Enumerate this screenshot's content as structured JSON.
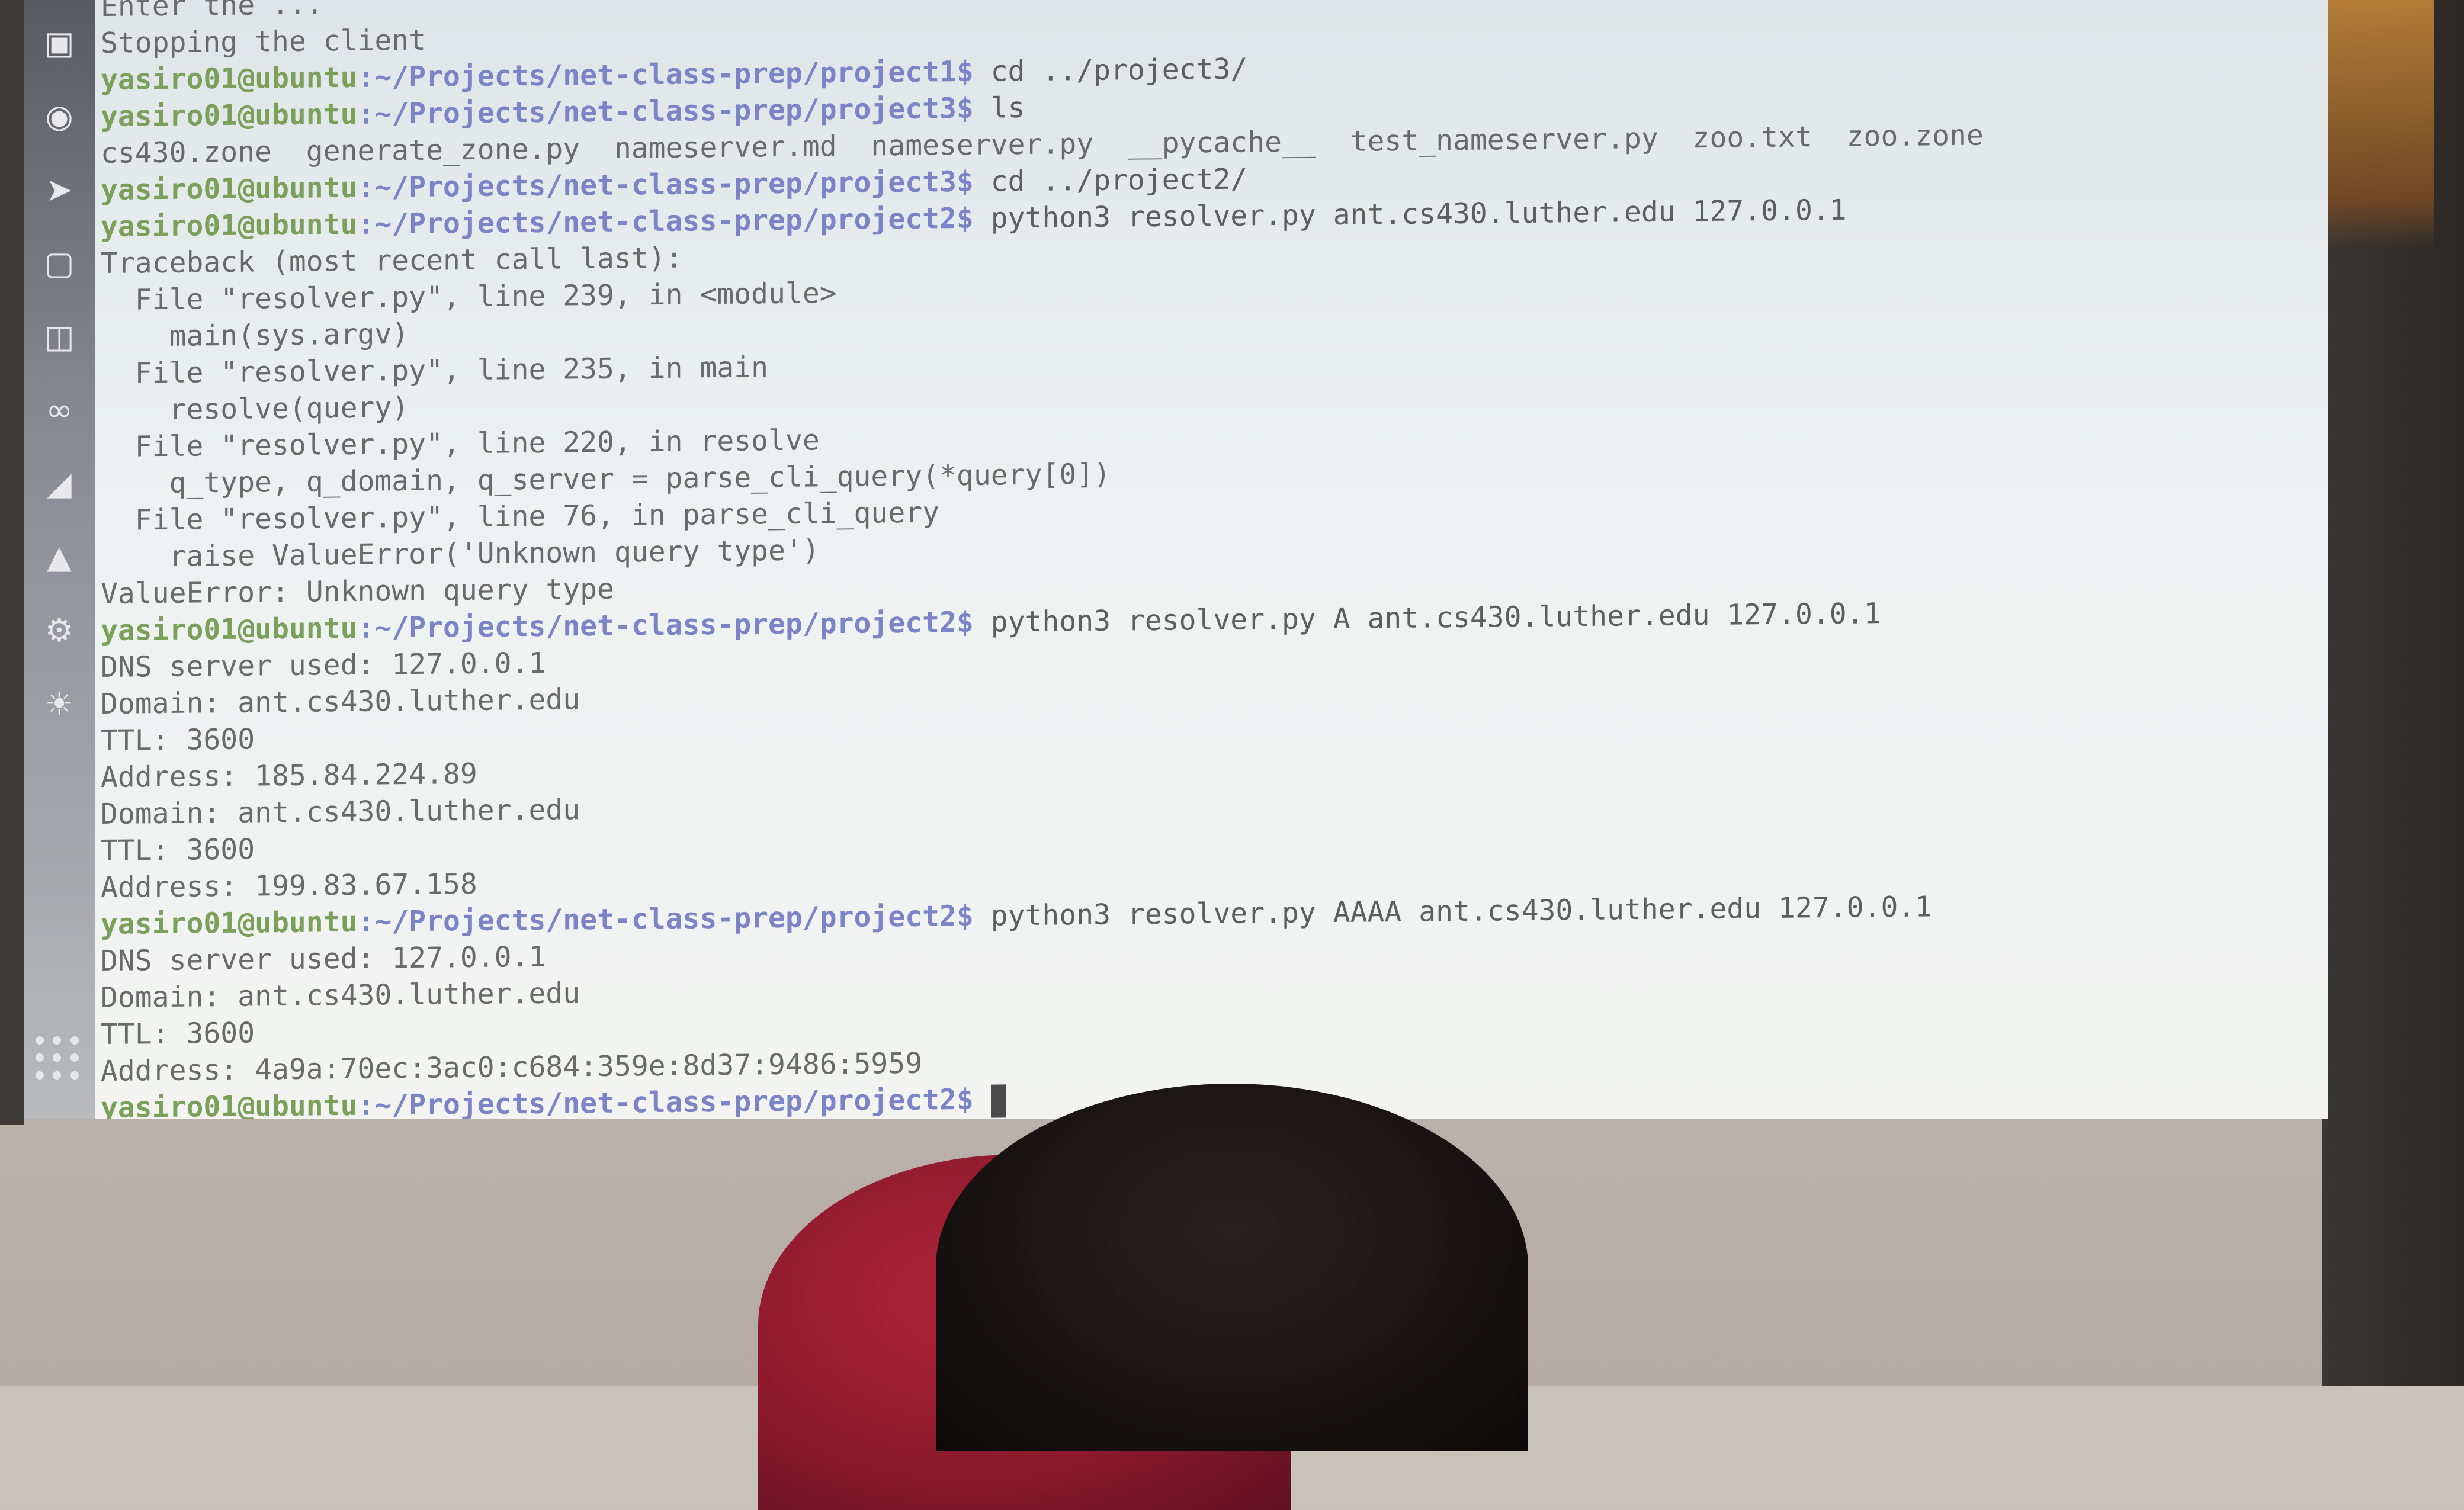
{
  "launcher": {
    "icons": [
      "terminal-icon",
      "chrome-icon",
      "thunderbird-icon",
      "files-icon",
      "database-icon",
      "infinity-icon",
      "disk-icon",
      "software-icon",
      "settings-icon",
      "sun-icon"
    ]
  },
  "terminal": {
    "lines": [
      {
        "type": "out",
        "text": "Enter the ..."
      },
      {
        "type": "out",
        "text": "Stopping the client"
      },
      {
        "type": "cmd",
        "user": "yasiro01@ubuntu",
        "path": ":~/Projects/net-class-prep/project1$",
        "cmd": " cd ../project3/"
      },
      {
        "type": "cmd",
        "user": "yasiro01@ubuntu",
        "path": ":~/Projects/net-class-prep/project3$",
        "cmd": " ls"
      },
      {
        "type": "out",
        "text": "cs430.zone  generate_zone.py  nameserver.md  nameserver.py  __pycache__  test_nameserver.py  zoo.txt  zoo.zone"
      },
      {
        "type": "cmd",
        "user": "yasiro01@ubuntu",
        "path": ":~/Projects/net-class-prep/project3$",
        "cmd": " cd ../project2/"
      },
      {
        "type": "cmd",
        "user": "yasiro01@ubuntu",
        "path": ":~/Projects/net-class-prep/project2$",
        "cmd": " python3 resolver.py ant.cs430.luther.edu 127.0.0.1"
      },
      {
        "type": "out",
        "text": "Traceback (most recent call last):"
      },
      {
        "type": "out",
        "text": "  File \"resolver.py\", line 239, in <module>"
      },
      {
        "type": "out",
        "text": "    main(sys.argv)"
      },
      {
        "type": "out",
        "text": "  File \"resolver.py\", line 235, in main"
      },
      {
        "type": "out",
        "text": "    resolve(query)"
      },
      {
        "type": "out",
        "text": "  File \"resolver.py\", line 220, in resolve"
      },
      {
        "type": "out",
        "text": "    q_type, q_domain, q_server = parse_cli_query(*query[0])"
      },
      {
        "type": "out",
        "text": "  File \"resolver.py\", line 76, in parse_cli_query"
      },
      {
        "type": "out",
        "text": "    raise ValueError('Unknown query type')"
      },
      {
        "type": "out",
        "text": "ValueError: Unknown query type"
      },
      {
        "type": "cmd",
        "user": "yasiro01@ubuntu",
        "path": ":~/Projects/net-class-prep/project2$",
        "cmd": " python3 resolver.py A ant.cs430.luther.edu 127.0.0.1"
      },
      {
        "type": "out",
        "text": "DNS server used: 127.0.0.1"
      },
      {
        "type": "out",
        "text": "Domain: ant.cs430.luther.edu"
      },
      {
        "type": "out",
        "text": "TTL: 3600"
      },
      {
        "type": "out",
        "text": "Address: 185.84.224.89"
      },
      {
        "type": "out",
        "text": "Domain: ant.cs430.luther.edu"
      },
      {
        "type": "out",
        "text": "TTL: 3600"
      },
      {
        "type": "out",
        "text": "Address: 199.83.67.158"
      },
      {
        "type": "cmd",
        "user": "yasiro01@ubuntu",
        "path": ":~/Projects/net-class-prep/project2$",
        "cmd": " python3 resolver.py AAAA ant.cs430.luther.edu 127.0.0.1"
      },
      {
        "type": "out",
        "text": "DNS server used: 127.0.0.1"
      },
      {
        "type": "out",
        "text": "Domain: ant.cs430.luther.edu"
      },
      {
        "type": "out",
        "text": "TTL: 3600"
      },
      {
        "type": "out",
        "text": "Address: 4a9a:70ec:3ac0:c684:359e:8d37:9486:5959"
      },
      {
        "type": "prompt",
        "user": "yasiro01@ubuntu",
        "path": ":~/Projects/net-class-prep/project2$",
        "cmd": " "
      }
    ]
  }
}
